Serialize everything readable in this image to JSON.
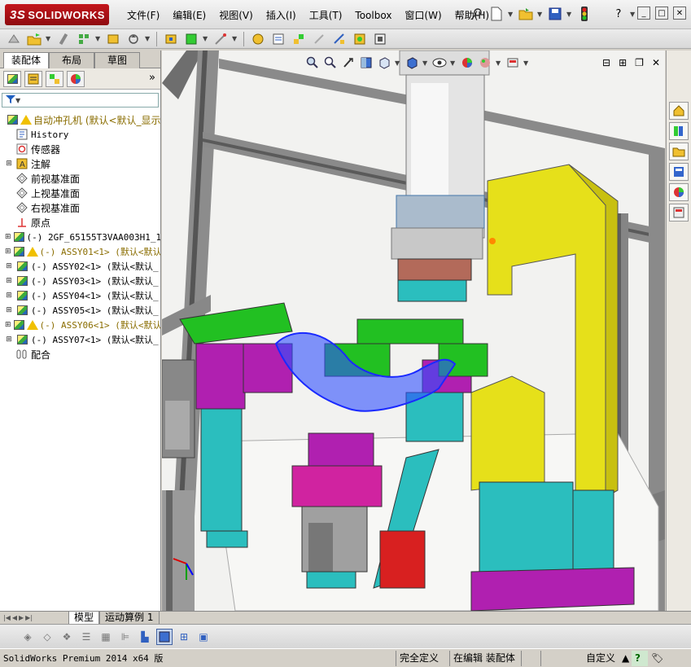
{
  "app": {
    "logo_prefix": "3S",
    "logo_text": "SOLIDWORKS"
  },
  "menu": [
    {
      "label": "文件(F)"
    },
    {
      "label": "编辑(E)"
    },
    {
      "label": "视图(V)"
    },
    {
      "label": "插入(I)"
    },
    {
      "label": "工具(T)"
    },
    {
      "label": "Toolbox"
    },
    {
      "label": "窗口(W)"
    },
    {
      "label": "帮助(H)"
    }
  ],
  "title_icons": [
    "pin-icon",
    "new-document-icon",
    "open-folder-icon",
    "save-icon",
    "traffic-light-icon",
    "help-icon"
  ],
  "help_glyph": "?",
  "panel_tabs": [
    {
      "label": "装配体",
      "active": true
    },
    {
      "label": "布局",
      "active": false
    },
    {
      "label": "草图",
      "active": false
    }
  ],
  "mgr_more": "»",
  "tree": [
    {
      "icon": "assembly-icon",
      "warn": true,
      "expander": "",
      "label": "自动冲孔机  (默认<默认_显示",
      "mono": false,
      "color": "#8a6d00"
    },
    {
      "icon": "history-icon",
      "warn": false,
      "expander": "",
      "label": "History",
      "mono": true,
      "color": "#000000"
    },
    {
      "icon": "sensor-icon",
      "warn": false,
      "expander": "",
      "label": "传感器",
      "mono": false,
      "color": "#000000"
    },
    {
      "icon": "annotation-icon",
      "warn": false,
      "expander": "+",
      "label": "注解",
      "mono": false,
      "color": "#000000"
    },
    {
      "icon": "plane-icon",
      "warn": false,
      "expander": "",
      "label": "前视基准面",
      "mono": false,
      "color": "#000000"
    },
    {
      "icon": "plane-icon",
      "warn": false,
      "expander": "",
      "label": "上视基准面",
      "mono": false,
      "color": "#000000"
    },
    {
      "icon": "plane-icon",
      "warn": false,
      "expander": "",
      "label": "右视基准面",
      "mono": false,
      "color": "#000000"
    },
    {
      "icon": "origin-icon",
      "warn": false,
      "expander": "",
      "label": "原点",
      "mono": false,
      "color": "#000000"
    },
    {
      "icon": "part-icon",
      "warn": false,
      "expander": "+",
      "label": "(-) 2GF_65155T3VAA003H1_14",
      "mono": true,
      "color": "#000000"
    },
    {
      "icon": "assembly-icon",
      "warn": true,
      "expander": "+",
      "label": "(-) ASSY01<1> (默认<默认",
      "mono": true,
      "color": "#8a6d00"
    },
    {
      "icon": "assembly-icon",
      "warn": false,
      "expander": "+",
      "label": "(-) ASSY02<1> (默认<默认_",
      "mono": true,
      "color": "#000000"
    },
    {
      "icon": "assembly-icon",
      "warn": false,
      "expander": "+",
      "label": "(-) ASSY03<1> (默认<默认_",
      "mono": true,
      "color": "#000000"
    },
    {
      "icon": "assembly-icon",
      "warn": false,
      "expander": "+",
      "label": "(-) ASSY04<1> (默认<默认_",
      "mono": true,
      "color": "#000000"
    },
    {
      "icon": "assembly-icon",
      "warn": false,
      "expander": "+",
      "label": "(-) ASSY05<1> (默认<默认_",
      "mono": true,
      "color": "#000000"
    },
    {
      "icon": "assembly-icon",
      "warn": true,
      "expander": "+",
      "label": "(-) ASSY06<1> (默认<默认",
      "mono": true,
      "color": "#8a6d00"
    },
    {
      "icon": "assembly-icon",
      "warn": false,
      "expander": "+",
      "label": "(-) ASSY07<1> (默认<默认_",
      "mono": true,
      "color": "#000000"
    },
    {
      "icon": "mates-icon",
      "warn": false,
      "expander": "",
      "label": "配合",
      "mono": false,
      "color": "#000000"
    }
  ],
  "bottom_tabs": [
    {
      "label": "模型",
      "active": true
    },
    {
      "label": "运动算例 1",
      "active": false
    }
  ],
  "status": {
    "app_version": "SolidWorks Premium 2014 x64 版",
    "defined": "完全定义",
    "editing": "在编辑 装配体",
    "custom": "自定义",
    "help": "?"
  },
  "colors": {
    "accent_red": "#c4161c",
    "frame_gray": "#8c8c8c",
    "press_yellow": "#e8e020",
    "fixture_green": "#22c022",
    "fixture_magenta": "#b020b0",
    "base_cyan": "#20c0c0",
    "selected_blue": "#2040ff"
  }
}
